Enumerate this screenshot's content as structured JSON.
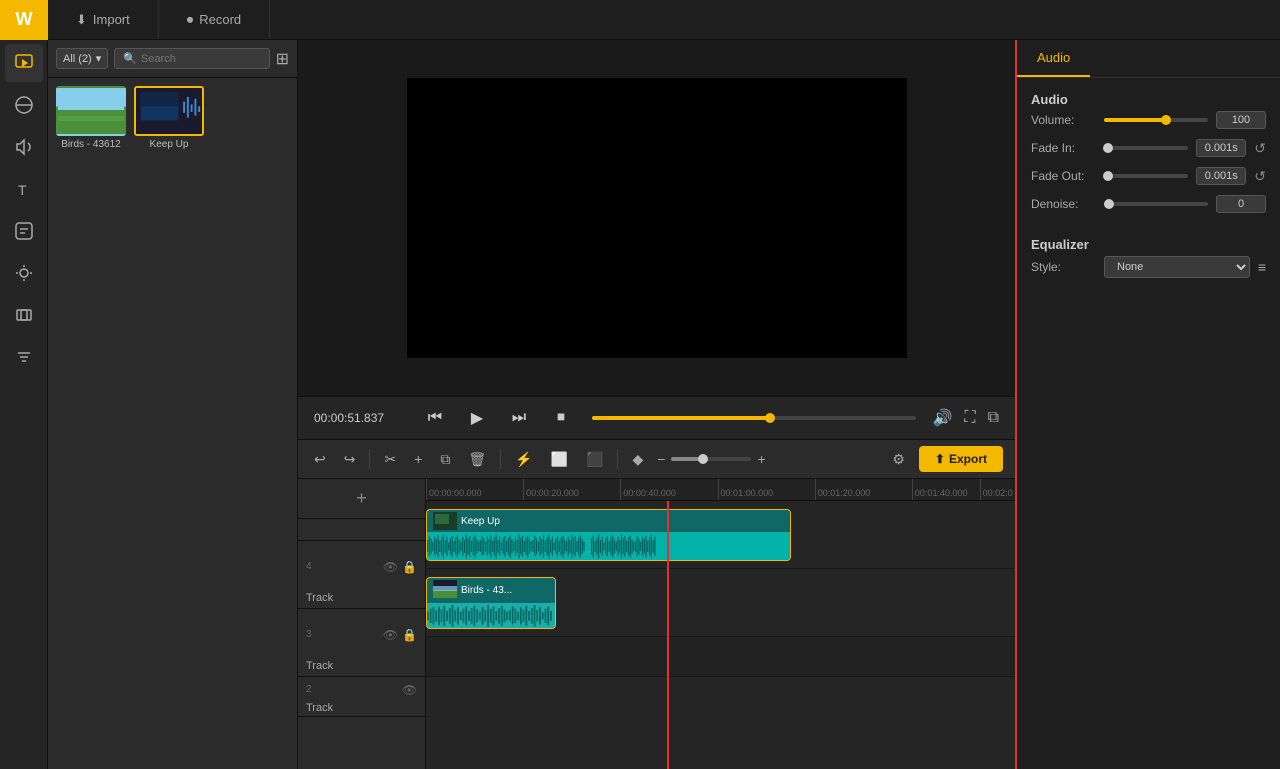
{
  "app": {
    "logo": "W",
    "logo_color": "#f5b800"
  },
  "topbar": {
    "import_label": "Import",
    "record_label": "Record",
    "import_icon": "⬇",
    "record_icon": "⏺"
  },
  "media_panel": {
    "filter_label": "All (2)",
    "search_placeholder": "Search",
    "items": [
      {
        "name": "Birds - 43612",
        "thumb_type": "birds"
      },
      {
        "name": "Keep Up",
        "thumb_type": "keepup"
      }
    ]
  },
  "preview": {
    "time_display": "00:00:51.837"
  },
  "toolbar": {
    "undo_label": "↩",
    "redo_label": "↪",
    "cut_label": "✂",
    "add_label": "+",
    "copy_label": "⧉",
    "delete_label": "🗑",
    "split_label": "⚡",
    "crop_label": "⬜",
    "expand_label": "⬛",
    "marker_label": "◆",
    "zoom_minus": "−",
    "zoom_plus": "+",
    "export_label": "Export",
    "export_icon": "⬆"
  },
  "timeline": {
    "ruler_times": [
      "00:00:00.000",
      "00:00:20.000",
      "00:00:40.000",
      "00:01:00.000",
      "00:01:20.000",
      "00:01:40.000",
      "00:02:0"
    ],
    "ruler_positions": [
      0,
      16,
      33,
      50,
      66,
      83,
      95
    ],
    "tracks": [
      {
        "number": "4",
        "label": "Track",
        "visible": true,
        "locked": false,
        "clips": [
          {
            "type": "video_audio",
            "label": "Keep Up",
            "left_pct": 0,
            "width_pct": 62,
            "color": "#1aaea8"
          }
        ]
      },
      {
        "number": "3",
        "label": "Track",
        "visible": true,
        "locked": false,
        "clips": [
          {
            "type": "video",
            "label": "Birds - 43...",
            "left_pct": 0,
            "width_pct": 22,
            "color": "#1aaea8"
          }
        ]
      },
      {
        "number": "2",
        "label": "Track",
        "visible": true,
        "locked": false,
        "clips": []
      }
    ]
  },
  "audio_panel": {
    "tab_label": "Audio",
    "section_audio": "Audio",
    "volume_label": "Volume:",
    "volume_value": "100",
    "fade_in_label": "Fade In:",
    "fade_in_value": "0.001s",
    "fade_out_label": "Fade Out:",
    "fade_out_value": "0.001s",
    "denoise_label": "Denoise:",
    "denoise_value": "0",
    "section_equalizer": "Equalizer",
    "style_label": "Style:",
    "style_value": "None"
  }
}
